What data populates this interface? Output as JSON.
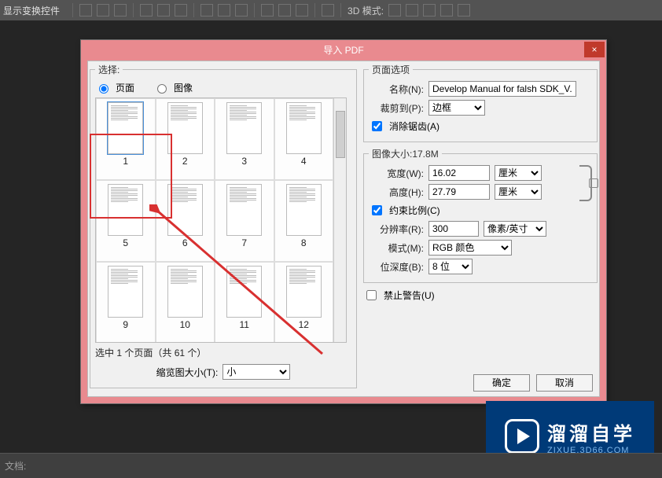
{
  "topbar": {
    "label": "显示变换控件",
    "mode3d_label": "3D 模式:"
  },
  "modal": {
    "title": "导入 PDF",
    "close": "×",
    "select": {
      "legend": "选择:",
      "opt_page": "页面",
      "opt_image": "图像",
      "page_count": 61,
      "visible_pages": [
        1,
        2,
        3,
        4,
        5,
        6,
        7,
        8,
        9,
        10,
        11,
        12
      ],
      "selected_page": 1,
      "info_prefix": "选中 1 个页面（共 ",
      "info_suffix": " 个）",
      "thumbsize_label": "缩览图大小(T):",
      "thumbsize_value": "小"
    },
    "page_options": {
      "legend": "页面选项",
      "name_label": "名称(N):",
      "name_value": "Develop Manual for falsh SDK_V.",
      "crop_label": "裁剪到(P):",
      "crop_value": "边框",
      "antialias_label": "消除锯齿(A)"
    },
    "image_size": {
      "legend": "图像大小:17.8M",
      "width_label": "宽度(W):",
      "width_value": "16.02",
      "width_unit": "厘米",
      "height_label": "高度(H):",
      "height_value": "27.79",
      "height_unit": "厘米",
      "constrain_label": "约束比例(C)",
      "res_label": "分辨率(R):",
      "res_value": "300",
      "res_unit": "像素/英寸",
      "mode_label": "模式(M):",
      "mode_value": "RGB 颜色",
      "depth_label": "位深度(B):",
      "depth_value": "8 位"
    },
    "suppress_label": "禁止警告(U)",
    "ok": "确定",
    "cancel": "取消"
  },
  "watermark": {
    "main": "溜溜自学",
    "sub": "ZIXUE.3D66.COM"
  },
  "bottom": {
    "doc_label": "文档:"
  }
}
